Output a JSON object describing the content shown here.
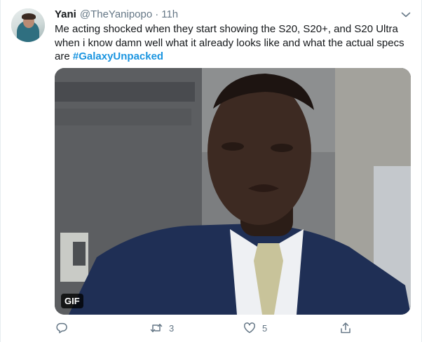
{
  "tweet": {
    "author_name": "Yani",
    "author_handle": "@TheYanipopo",
    "separator": "·",
    "time": "11h",
    "text_line_1": "Me acting shocked when they start showing the S20, S20+, and S20 Ultra",
    "text_line_2": "when i know damn well what it already looks like and what the actual specs",
    "text_line_3_prefix": "are ",
    "hashtag": "#GalaxyUnpacked",
    "media_badge": "GIF",
    "retweet_count": "3",
    "like_count": "5"
  },
  "icons": {
    "caret": "chevron-down-icon",
    "reply": "reply-icon",
    "retweet": "retweet-icon",
    "like": "heart-icon",
    "share": "share-icon"
  },
  "colors": {
    "text_primary": "#14171a",
    "text_secondary": "#657786",
    "link": "#1b95e0",
    "border": "#e6ecf0"
  }
}
